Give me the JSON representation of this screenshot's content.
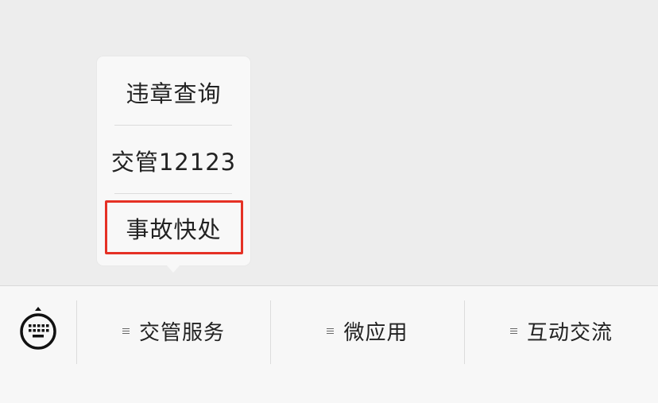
{
  "submenu": {
    "items": [
      {
        "label": "违章查询"
      },
      {
        "label": "交管12123"
      },
      {
        "label": "事故快处"
      }
    ],
    "highlight_color": "#e53125"
  },
  "menubar": {
    "keyboard_icon": "keyboard-icon",
    "items": [
      {
        "label": "交管服务",
        "icon": "menu-lines-icon"
      },
      {
        "label": "微应用",
        "icon": "menu-lines-icon"
      },
      {
        "label": "互动交流",
        "icon": "menu-lines-icon"
      }
    ]
  }
}
